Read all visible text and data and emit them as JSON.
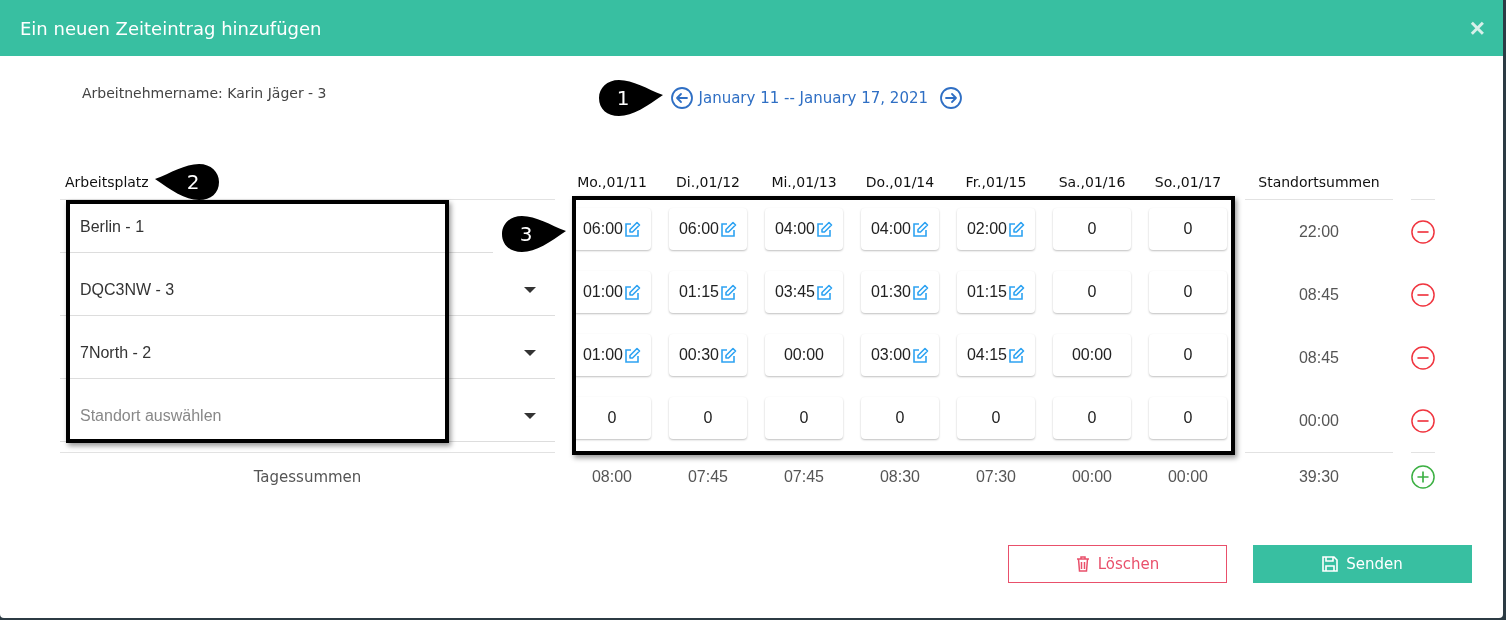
{
  "dialog": {
    "title": "Ein neuen Zeiteintrag hinzufügen",
    "close": "×"
  },
  "employee": "Arbeitnehmername: Karin Jäger - 3",
  "week_nav": {
    "callout": "1",
    "range": "January 11 -- January 17, 2021"
  },
  "table": {
    "location_header": "Arbeitsplatz",
    "location_callout": "2",
    "location_outlined": true,
    "days_callout": "3",
    "days_outlined": true,
    "days": [
      "Mo.,01/11",
      "Di.,01/12",
      "Mi.,01/13",
      "Do.,01/14",
      "Fr.,01/15",
      "Sa.,01/16",
      "So.,01/17"
    ],
    "sum_header": "Standortsummen",
    "rows": [
      {
        "location": "Berlin - 1",
        "dropdown": false,
        "entries": [
          {
            "value": "06:00",
            "editable": true
          },
          {
            "value": "06:00",
            "editable": true
          },
          {
            "value": "04:00",
            "editable": true
          },
          {
            "value": "04:00",
            "editable": true
          },
          {
            "value": "02:00",
            "editable": true
          },
          {
            "value": "0",
            "editable": false
          },
          {
            "value": "0",
            "editable": false
          }
        ],
        "total": "22:00"
      },
      {
        "location": "DQC3NW - 3",
        "dropdown": true,
        "entries": [
          {
            "value": "01:00",
            "editable": true
          },
          {
            "value": "01:15",
            "editable": true
          },
          {
            "value": "03:45",
            "editable": true
          },
          {
            "value": "01:30",
            "editable": true
          },
          {
            "value": "01:15",
            "editable": true
          },
          {
            "value": "0",
            "editable": false
          },
          {
            "value": "0",
            "editable": false
          }
        ],
        "total": "08:45"
      },
      {
        "location": "7North - 2",
        "dropdown": true,
        "entries": [
          {
            "value": "01:00",
            "editable": true
          },
          {
            "value": "00:30",
            "editable": true
          },
          {
            "value": "00:00",
            "editable": false
          },
          {
            "value": "03:00",
            "editable": true
          },
          {
            "value": "04:15",
            "editable": true
          },
          {
            "value": "00:00",
            "editable": false
          },
          {
            "value": "0",
            "editable": false
          }
        ],
        "total": "08:45"
      },
      {
        "placeholder": "Standort auswählen",
        "dropdown": true,
        "entries": [
          {
            "value": "0",
            "editable": false
          },
          {
            "value": "0",
            "editable": false
          },
          {
            "value": "0",
            "editable": false
          },
          {
            "value": "0",
            "editable": false
          },
          {
            "value": "0",
            "editable": false
          },
          {
            "value": "0",
            "editable": false
          },
          {
            "value": "0",
            "editable": false
          }
        ],
        "total": "00:00"
      }
    ],
    "totals": {
      "label": "Tagessummen",
      "days": [
        "08:00",
        "07:45",
        "07:45",
        "08:30",
        "07:30",
        "00:00",
        "00:00"
      ],
      "total": "39:30"
    }
  },
  "buttons": [
    {
      "kind": "delete",
      "label": "Löschen"
    },
    {
      "kind": "send",
      "label": "Senden"
    }
  ]
}
